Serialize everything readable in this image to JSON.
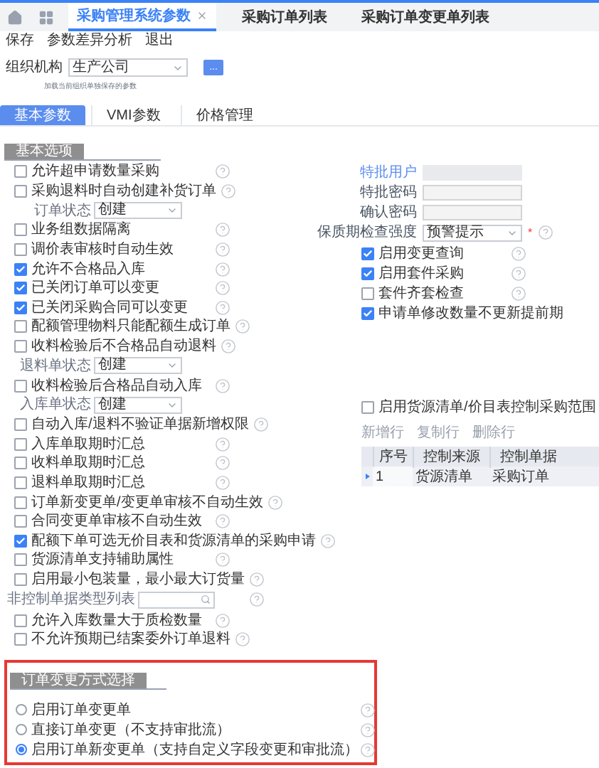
{
  "tabs": [
    {
      "label": "采购管理系统参数",
      "selected": true,
      "closable": true
    },
    {
      "label": "采购订单列表",
      "selected": false,
      "closable": false
    },
    {
      "label": "采购订单变更单列表",
      "selected": false,
      "closable": false
    }
  ],
  "toolbar": [
    "保存",
    "参数差异分析",
    "退出"
  ],
  "org": {
    "label": "组织机构",
    "value": "生产公司",
    "button": "...",
    "note": "加载当前组织单独保存的参数"
  },
  "subtabs": [
    {
      "label": "基本参数",
      "selected": true
    },
    {
      "label": "VMI参数",
      "selected": false
    },
    {
      "label": "价格管理",
      "selected": false
    }
  ],
  "basic": {
    "title": "基本选项",
    "items": [
      {
        "kind": "checkbox",
        "label": "允许超申请数量采购",
        "checked": false,
        "help": true
      },
      {
        "kind": "checkbox",
        "label": "采购退料时自动创建补货订单",
        "checked": false,
        "help": true
      },
      {
        "kind": "select",
        "label": "订单状态",
        "value": "创建",
        "help": false
      },
      {
        "kind": "checkbox",
        "label": "业务组数据隔离",
        "checked": false,
        "help": true
      },
      {
        "kind": "checkbox",
        "label": "调价表审核时自动生效",
        "checked": false,
        "help": true
      },
      {
        "kind": "checkbox",
        "label": "允许不合格品入库",
        "checked": true,
        "help": true
      },
      {
        "kind": "checkbox",
        "label": "已关闭订单可以变更",
        "checked": true,
        "help": true
      },
      {
        "kind": "checkbox",
        "label": "已关闭采购合同可以变更",
        "checked": true,
        "help": true
      },
      {
        "kind": "checkbox",
        "label": "配额管理物料只能配额生成订单",
        "checked": false,
        "help": true
      },
      {
        "kind": "checkbox",
        "label": "收料检验后不合格品自动退料",
        "checked": false,
        "help": true
      },
      {
        "kind": "select",
        "label": "退料单状态",
        "value": "创建",
        "help": false
      },
      {
        "kind": "checkbox",
        "label": "收料检验后合格品自动入库",
        "checked": false,
        "help": true
      },
      {
        "kind": "select",
        "label": "入库单状态",
        "value": "创建",
        "help": false
      },
      {
        "kind": "checkbox",
        "label": "自动入库/退料不验证单据新增权限",
        "checked": false,
        "help": true
      },
      {
        "kind": "checkbox",
        "label": "入库单取期时汇总",
        "checked": false,
        "help": true
      },
      {
        "kind": "checkbox",
        "label": "收料单取期时汇总",
        "checked": false,
        "help": true
      },
      {
        "kind": "checkbox",
        "label": "退料单取期时汇总",
        "checked": false,
        "help": true
      },
      {
        "kind": "checkbox",
        "label": "订单新变更单/变更单审核不自动生效",
        "checked": false,
        "help": true
      },
      {
        "kind": "checkbox",
        "label": "合同变更单审核不自动生效",
        "checked": false,
        "help": true
      },
      {
        "kind": "checkbox",
        "label": "配额下单可选无价目表和货源清单的采购申请",
        "checked": true,
        "help": true
      },
      {
        "kind": "checkbox",
        "label": "货源清单支持辅助属性",
        "checked": false,
        "help": true
      },
      {
        "kind": "checkbox",
        "label": "启用最小包装量，最小最大订货量",
        "checked": false,
        "help": true
      },
      {
        "kind": "search",
        "label": "非控制单据类型列表",
        "help": true
      },
      {
        "kind": "checkbox",
        "label": "允许入库数量大于质检数量",
        "checked": false,
        "help": true
      },
      {
        "kind": "checkbox",
        "label": "不允许预期已结案委外订单退料",
        "checked": false,
        "help": true
      }
    ]
  },
  "right": {
    "items": [
      {
        "kind": "readonly",
        "label": "特批用户"
      },
      {
        "kind": "password",
        "label": "特批密码"
      },
      {
        "kind": "password",
        "label": "确认密码"
      },
      {
        "kind": "select",
        "label": "保质期检查强度",
        "value": "预警提示",
        "required_mark": "*",
        "help": true
      },
      {
        "kind": "checkbox",
        "label": "启用变更查询",
        "checked": true,
        "help": true
      },
      {
        "kind": "checkbox",
        "label": "启用套件采购",
        "checked": true,
        "help": true
      },
      {
        "kind": "checkbox",
        "label": "套件齐套检查",
        "checked": false,
        "help": true
      },
      {
        "kind": "checkbox",
        "label": "申请单修改数量不更新提前期",
        "checked": true,
        "help": false
      }
    ]
  },
  "source": {
    "label": "启用货源清单/价目表控制采购范围",
    "checked": false,
    "actions": [
      "新增行",
      "复制行",
      "删除行"
    ],
    "columns": [
      "序号",
      "控制来源",
      "控制单据"
    ],
    "rows": [
      {
        "cells": [
          "1",
          "货源清单",
          "采购订单"
        ],
        "current": true
      }
    ]
  },
  "change": {
    "title": "订单变更方式选择",
    "options": [
      {
        "label": "启用订单变更单",
        "selected": false,
        "help": true
      },
      {
        "label": "直接订单变更（不支持审批流）",
        "selected": false,
        "help": true
      },
      {
        "label": "启用订单新变更单（支持自定义字段变更和审批流）",
        "selected": true,
        "help": true
      }
    ]
  }
}
